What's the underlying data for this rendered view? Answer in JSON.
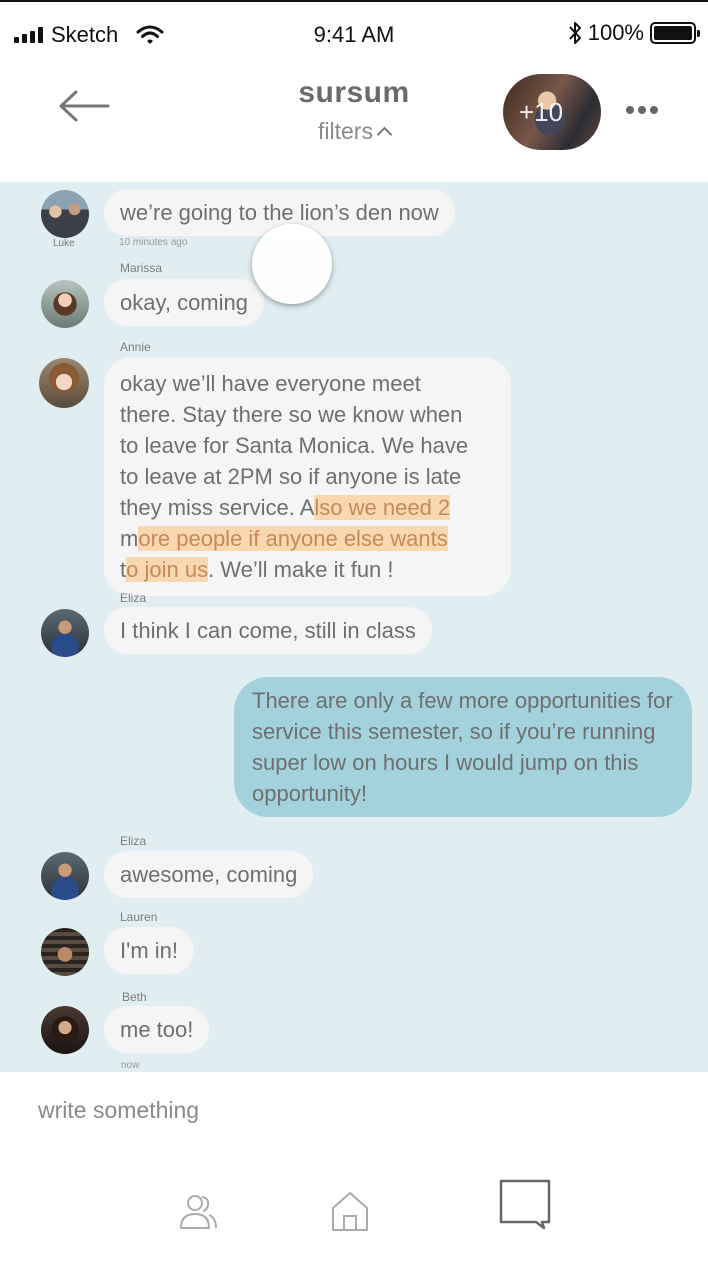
{
  "status_bar": {
    "carrier": "Sketch",
    "time": "9:41 AM",
    "battery": "100%"
  },
  "header": {
    "title": "sursum",
    "filters_label": "filters",
    "group_count": "+10"
  },
  "messages": [
    {
      "sender": "Luke",
      "text": "we’re going to the lion’s den now",
      "timestamp": "10 minutes ago",
      "avatar_label": "Luke"
    },
    {
      "sender": "Marissa",
      "text": "okay, coming"
    },
    {
      "sender": "Annie",
      "text_lines": [
        "okay we’ll have everyone meet",
        "there. Stay there so we know when",
        "to leave for Santa Monica. We have",
        "to leave at 2PM so if anyone is late"
      ],
      "line5_plain": "they miss service. A",
      "line5_hl": "lso we need 2 ",
      "line6_plain": "m",
      "line6_hl": "ore people if anyone else wants ",
      "line7_plain": "t",
      "line7_hl": "o join us",
      "line7_tail": ". We’ll make it fun !"
    },
    {
      "sender": "Eliza",
      "text": "I think I can come, still in class"
    },
    {
      "sender": "me",
      "text": "There are only a few more opportunities for service this semester, so if you’re running super low on hours I would jump on this opportunity!"
    },
    {
      "sender": "Eliza",
      "text": "awesome, coming"
    },
    {
      "sender": "Lauren",
      "text": "I'm in!"
    },
    {
      "sender": "Beth",
      "text": "me too!",
      "timestamp": "now"
    }
  ],
  "composer": {
    "placeholder": "write something"
  },
  "tabs": [
    {
      "name": "people-icon"
    },
    {
      "name": "home-icon"
    },
    {
      "name": "chat-icon",
      "active": true
    }
  ],
  "colors": {
    "chat_background": "#e0eef2",
    "bubble": "#f5f5f5",
    "own_bubble": "#a4d2dc",
    "highlight": "#f9d7b0"
  }
}
